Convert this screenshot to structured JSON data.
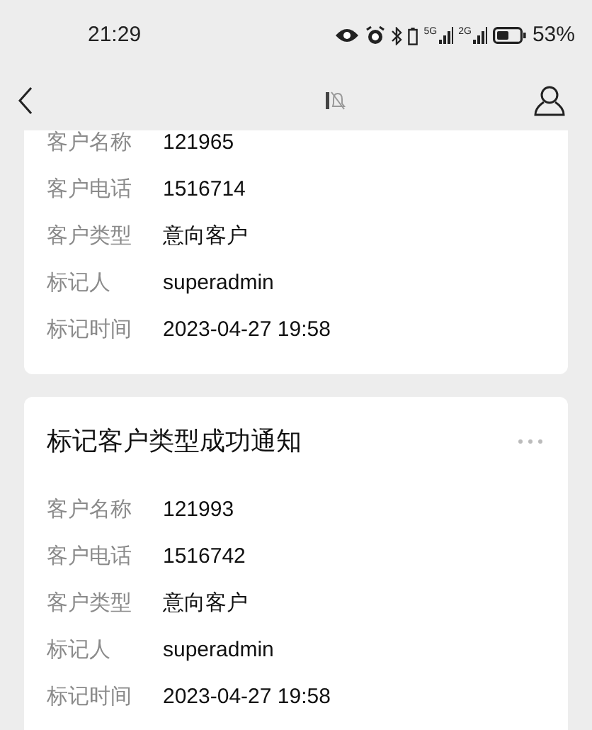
{
  "status_bar": {
    "time": "21:29",
    "signal_1": "5G",
    "signal_2": "2G",
    "battery": "53%"
  },
  "cards": [
    {
      "rows": [
        {
          "label": "客户名称",
          "value": "121965"
        },
        {
          "label": "客户电话",
          "value": "1516714"
        },
        {
          "label": "客户类型",
          "value": "意向客户"
        },
        {
          "label": "标记人",
          "value": "superadmin"
        },
        {
          "label": "标记时间",
          "value": "2023-04-27 19:58"
        }
      ]
    },
    {
      "title": "标记客户类型成功通知",
      "rows": [
        {
          "label": "客户名称",
          "value": "121993"
        },
        {
          "label": "客户电话",
          "value": "1516742"
        },
        {
          "label": "客户类型",
          "value": "意向客户"
        },
        {
          "label": "标记人",
          "value": "superadmin"
        },
        {
          "label": "标记时间",
          "value": "2023-04-27 19:58"
        }
      ]
    }
  ]
}
